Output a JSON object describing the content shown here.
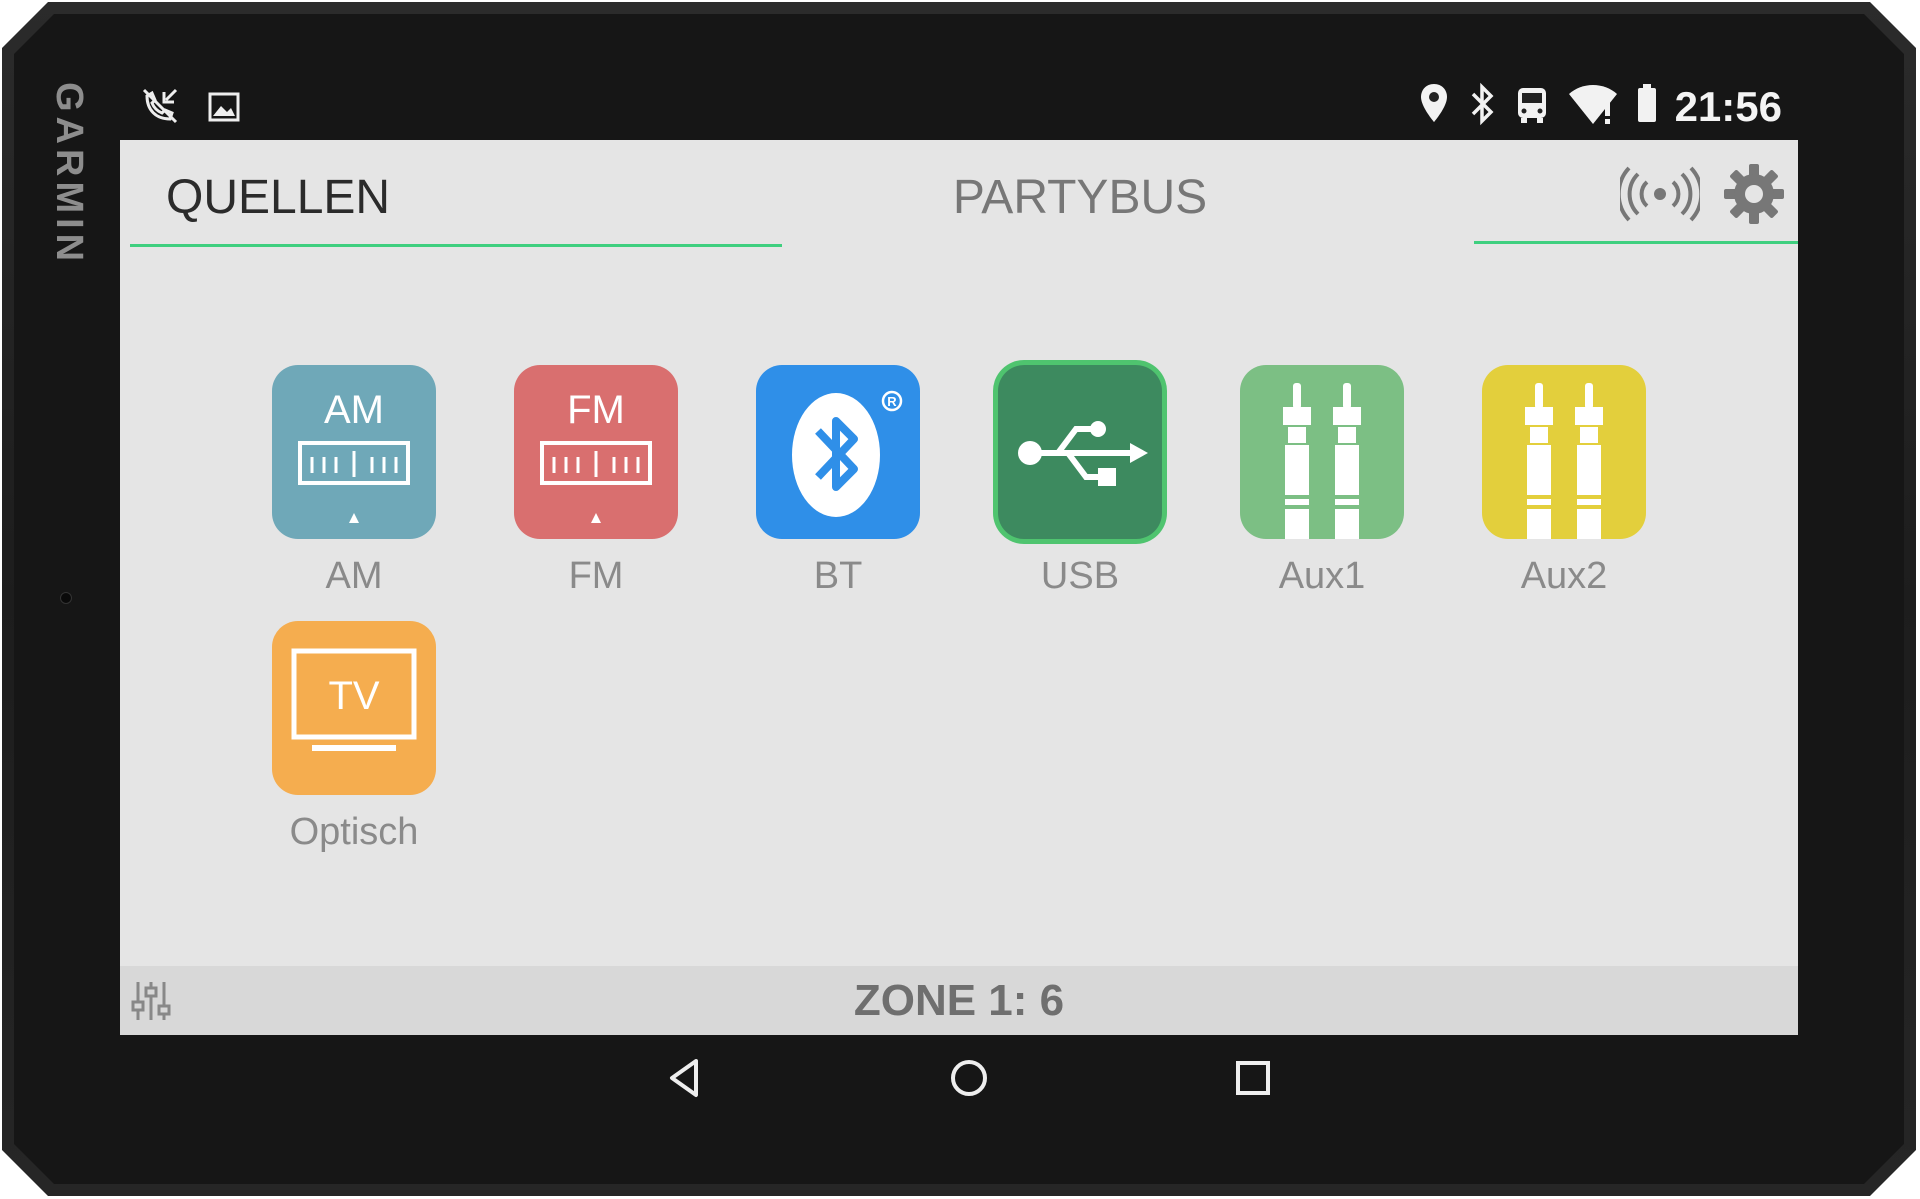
{
  "device": {
    "brand": "GARMIN"
  },
  "statusbar": {
    "left_icons": [
      "no-call-icon",
      "image-icon"
    ],
    "right_icons": [
      "location-pin-icon",
      "bluetooth-icon",
      "bus-icon",
      "wifi-alert-icon",
      "battery-icon"
    ],
    "time": "21:56"
  },
  "tabs": {
    "sources_label": "QUELLEN",
    "partybus_label": "PARTYBUS"
  },
  "sources": [
    {
      "id": "am",
      "label": "AM",
      "icon_text": "AM",
      "color": "#6fa8b8"
    },
    {
      "id": "fm",
      "label": "FM",
      "icon_text": "FM",
      "color": "#d96f6f"
    },
    {
      "id": "bt",
      "label": "BT",
      "color": "#2f8fe8"
    },
    {
      "id": "usb",
      "label": "USB",
      "color": "#3d8a5f",
      "selected": true
    },
    {
      "id": "aux1",
      "label": "Aux1",
      "color": "#7cbf84"
    },
    {
      "id": "aux2",
      "label": "Aux2",
      "color": "#e3cf3c"
    },
    {
      "id": "optical",
      "label": "Optisch",
      "icon_text": "TV",
      "color": "#f5ad4f"
    }
  ],
  "bottombar": {
    "zone_text": "ZONE 1: 6"
  },
  "colors": {
    "accent": "#3fcf7f",
    "screen_bg": "#e5e5e5"
  },
  "navbar": {
    "icons": [
      "back-icon",
      "home-icon",
      "recents-icon"
    ]
  }
}
